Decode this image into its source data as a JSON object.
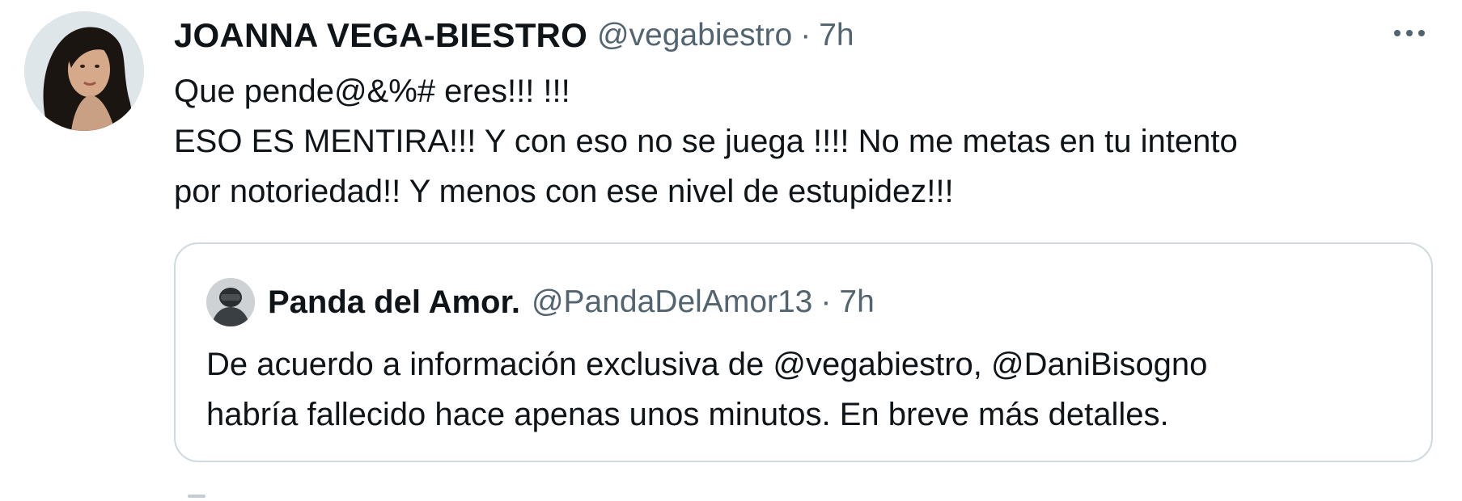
{
  "tweet": {
    "author": {
      "display_name": "JOANNA VEGA-BIESTRO",
      "handle": "@vegabiestro",
      "separator": "·",
      "time": "7h"
    },
    "text_lines": [
      "Que pende@&%# eres!!! !!!",
      "ESO ES MENTIRA!!! Y con eso no se juega !!!! No me metas en tu intento",
      "por notoriedad!! Y menos con ese nivel de estupidez!!!"
    ],
    "more_icon": "more-horizontal-icon"
  },
  "quoted": {
    "author": {
      "display_name": "Panda del Amor.",
      "handle": "@PandaDelAmor13",
      "separator": "·",
      "time": "7h"
    },
    "text_lines": [
      "De acuerdo a  información exclusiva de @vegabiestro, @DaniBisogno",
      "habría fallecido hace apenas unos minutos. En breve más detalles."
    ]
  },
  "colors": {
    "text_primary": "#0f1419",
    "text_secondary": "#536471",
    "border": "#cfd9de",
    "background": "#ffffff"
  }
}
